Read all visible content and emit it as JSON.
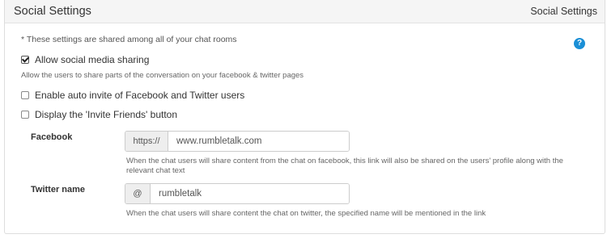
{
  "header": {
    "title": "Social Settings",
    "breadcrumb": "Social Settings"
  },
  "note": "* These settings are shared among all of your chat rooms",
  "help_icon": {
    "glyph": "?",
    "color": "#1b8fd6"
  },
  "options": {
    "allow_sharing": {
      "label": "Allow social media sharing",
      "checked": true,
      "description": "Allow the users to share parts of the conversation on your facebook & twitter pages"
    },
    "auto_invite": {
      "label": "Enable auto invite of Facebook and Twitter users",
      "checked": false
    },
    "invite_friends": {
      "label": "Display the 'Invite Friends' button",
      "checked": false
    }
  },
  "facebook": {
    "label": "Facebook",
    "prefix": "https://",
    "value": "www.rumbletalk.com",
    "help_line1": "When the chat users will share content from the chat on facebook, this link will also be shared on the users' profile along with the",
    "help_line2": "relevant chat text"
  },
  "twitter": {
    "label": "Twitter name",
    "prefix": "@",
    "value": "rumbletalk",
    "help": "When the chat users will share content the chat on twitter, the specified name will be mentioned in the link"
  }
}
